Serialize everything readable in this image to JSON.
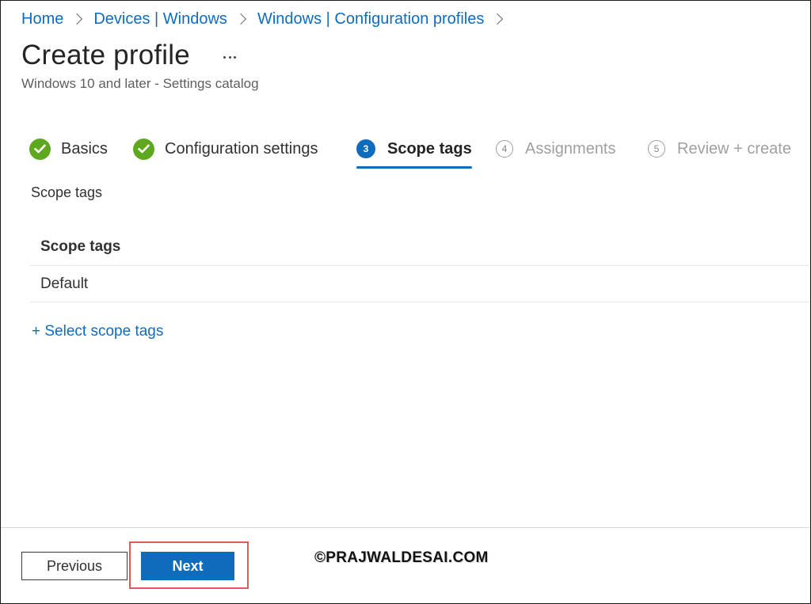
{
  "breadcrumb": [
    {
      "label": "Home"
    },
    {
      "label": "Devices | Windows"
    },
    {
      "label": "Windows | Configuration profiles"
    }
  ],
  "page": {
    "title": "Create profile",
    "subtitle": "Windows 10 and later - Settings catalog",
    "more_icon": "ellipsis-icon"
  },
  "wizard": {
    "steps": [
      {
        "label": "Basics",
        "state": "completed",
        "icon": "check-icon"
      },
      {
        "label": "Configuration settings",
        "state": "completed",
        "icon": "check-icon"
      },
      {
        "number": "3",
        "label": "Scope tags",
        "state": "active"
      },
      {
        "number": "4",
        "label": "Assignments",
        "state": "disabled"
      },
      {
        "number": "5",
        "label": "Review + create",
        "state": "disabled"
      }
    ]
  },
  "scope_tags": {
    "section_label": "Scope tags",
    "table_header": "Scope tags",
    "rows": [
      "Default"
    ],
    "select_link": "+ Select scope tags"
  },
  "footer": {
    "previous_label": "Previous",
    "next_label": "Next"
  },
  "watermark": "©PRAJWALDESAI.COM",
  "colors": {
    "accent": "#0f6cbd",
    "success": "#5ea81f",
    "highlight": "#e05a5a"
  }
}
